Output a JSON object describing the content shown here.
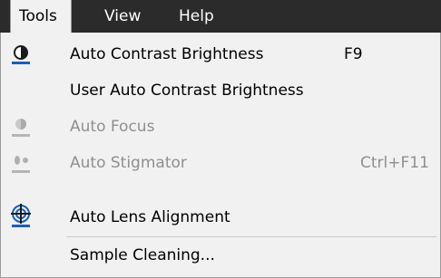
{
  "menubar": {
    "menus": [
      {
        "label": "Tools"
      },
      {
        "label": "View"
      },
      {
        "label": "Help"
      }
    ],
    "open_menu": "Tools"
  },
  "dropdown": {
    "items": [
      {
        "label": "Auto Contrast Brightness",
        "shortcut": "F9",
        "icon": "contrast-brightness-icon",
        "enabled": true
      },
      {
        "label": "User Auto Contrast Brightness",
        "shortcut": "",
        "icon": "",
        "enabled": true
      },
      {
        "label": "Auto Focus",
        "shortcut": "",
        "icon": "focus-icon",
        "enabled": false
      },
      {
        "label": "Auto Stigmator",
        "shortcut": "Ctrl+F11",
        "icon": "stigmator-icon",
        "enabled": false
      },
      {
        "label": "Auto Lens Alignment",
        "shortcut": "",
        "icon": "lens-alignment-icon",
        "enabled": true
      },
      {
        "label": "Sample Cleaning...",
        "shortcut": "",
        "icon": "",
        "enabled": true
      }
    ]
  },
  "colors": {
    "menubar_bg": "#2b2b2b",
    "dropdown_bg": "#f1f1f1",
    "icon_blue": "#1a5fb4",
    "disabled_text": "#8f8f8f"
  }
}
